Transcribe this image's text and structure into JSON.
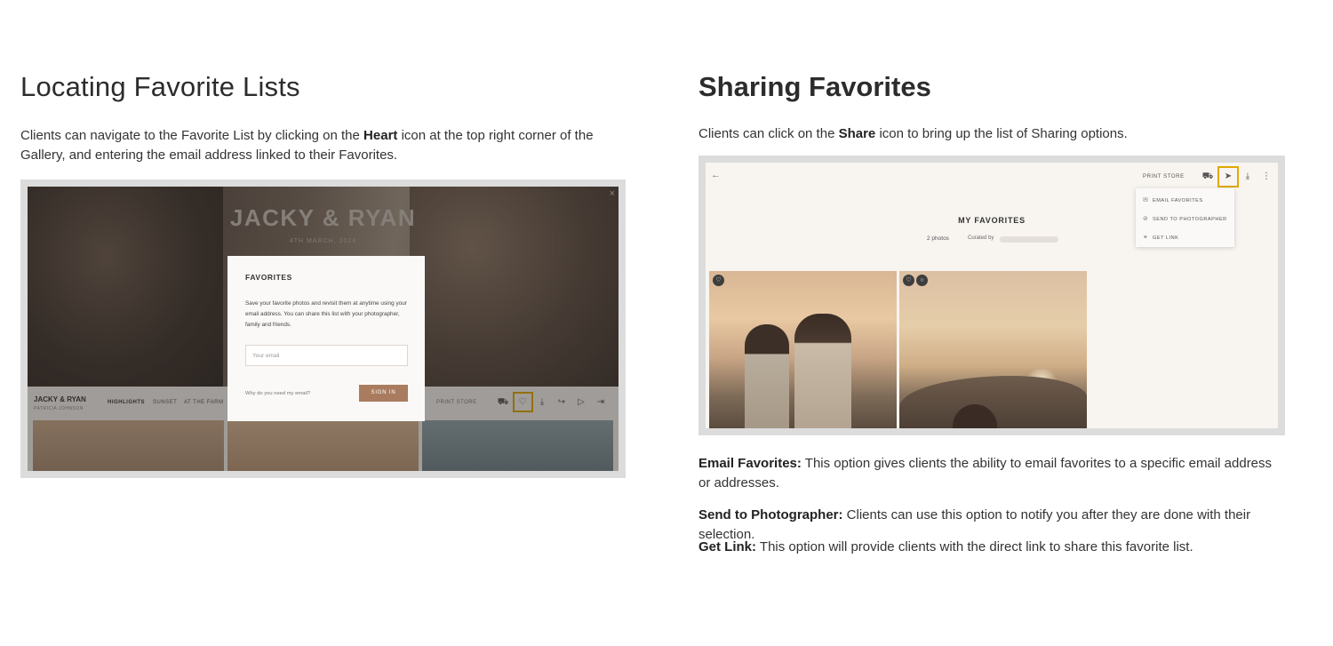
{
  "left": {
    "heading": "Locating Favorite Lists",
    "para_pre": "Clients can navigate to the Favorite List by clicking on the ",
    "para_bold": "Heart",
    "para_post": " icon at the top right corner of the Gallery, and entering the email address linked to their Favorites.",
    "screenshot": {
      "hero_title": "JACKY & RYAN",
      "hero_date": "4TH MARCH, 2024",
      "gallery_name": "JACKY & RYAN",
      "gallery_sub": "PATRICIA JOHNSON",
      "nav": [
        "HIGHLIGHTS",
        "SUNSET",
        "AT THE FARM"
      ],
      "print_store": "PRINT STORE",
      "modal": {
        "title": "FAVORITES",
        "text": "Save your favorite photos and revisit them at anytime using your email address. You can share this list with your photographer, family and friends.",
        "email_placeholder": "Your email",
        "why_link": "Why do you need my email?",
        "sign_in": "SIGN IN"
      },
      "icons": [
        "cart-icon",
        "heart-icon",
        "download-icon",
        "share-icon",
        "play-icon",
        "logout-icon"
      ]
    }
  },
  "right": {
    "heading": "Sharing Favorites",
    "para_pre": "Clients can click on the ",
    "para_bold": "Share",
    "para_post": " icon to bring up the list of Sharing options.",
    "screenshot": {
      "print_store": "PRINT STORE",
      "title": "MY FAVORITES",
      "photo_count": "2 photos",
      "curated_by": "Curated by",
      "dropdown": [
        "EMAIL FAVORITES",
        "SEND TO PHOTOGRAPHER",
        "GET LINK"
      ],
      "icons": [
        "back-icon",
        "cart-icon",
        "share-icon",
        "download-icon",
        "more-icon"
      ]
    },
    "options": [
      {
        "label": "Email Favorites:",
        "text": " This option gives clients the ability to email favorites to a specific email address or addresses."
      },
      {
        "label": "Send to Photographer:",
        "text": " Clients can use this option to notify you after they are done with their selection."
      },
      {
        "label": "Get Link:",
        "text": " This option will provide clients with the direct link to share this favorite list."
      }
    ]
  },
  "colors": {
    "highlight_box": "#e0a800",
    "sign_in_button": "#a97c5f",
    "text": "#333333"
  }
}
